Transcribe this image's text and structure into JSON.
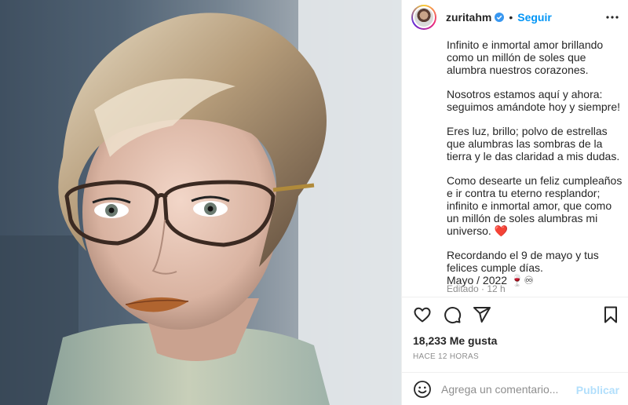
{
  "post": {
    "username": "zuritahm",
    "verified_icon": "verified-badge-icon",
    "follow_label": "Seguir",
    "caption": [
      "Infinito e inmortal amor brillando como un millón de soles que alumbra nuestros corazones.",
      "Nosotros estamos aquí y ahora: seguimos amándote hoy y siempre!",
      "Eres luz, brillo; polvo de estrellas que alumbras las sombras de la tierra y le das claridad a mis dudas.",
      "Como desearte un feliz cumpleaños e ir contra tu eterno resplandor; infinito e inmortal amor, que como un millón de soles alumbras mi universo. ❤️",
      "Recordando el 9 de mayo y tus felices cumple días.",
      "Mayo / 2022 🍷♾"
    ],
    "edited_label": "Editado · 12 h",
    "likes": "18,233 Me gusta",
    "timestamp": "HACE 12 HORAS",
    "comment_placeholder": "Agrega un comentario...",
    "publish_label": "Publicar"
  },
  "colors": {
    "accent": "#0095f6",
    "publish_disabled": "#b2dffc",
    "muted": "#8e8e8e",
    "text": "#262626"
  },
  "icons": [
    "more-options-icon",
    "heart-icon",
    "comment-icon",
    "share-icon",
    "bookmark-icon",
    "emoji-icon"
  ]
}
